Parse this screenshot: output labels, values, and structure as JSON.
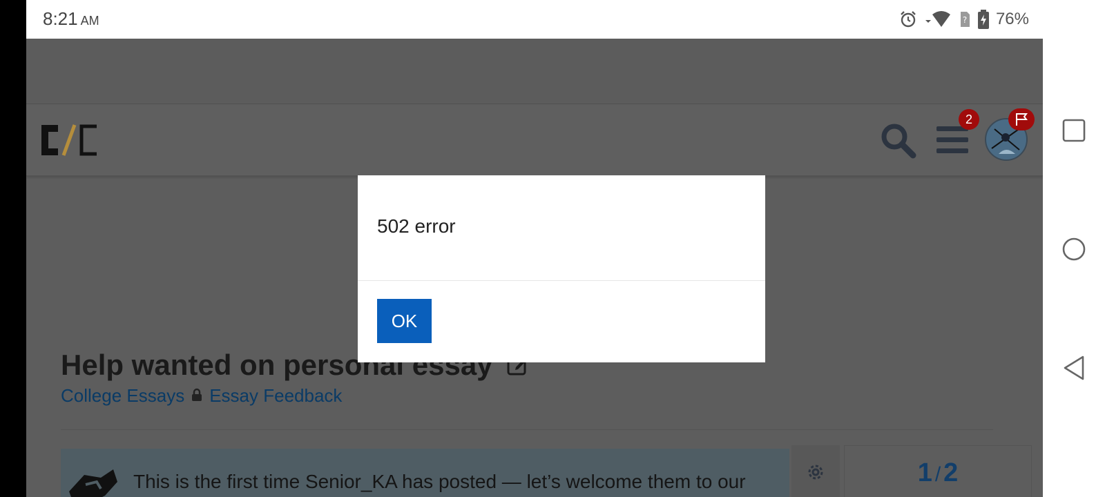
{
  "status_bar": {
    "time": "8:21",
    "ampm": "AM",
    "battery": "76%"
  },
  "header": {
    "logo_alt": "College Confidential",
    "notifications_count": "2"
  },
  "topic": {
    "title": "Help wanted on personal essay",
    "category": "College Essays",
    "subcategory": "Essay Feedback"
  },
  "welcome_banner": {
    "text": "This is the first time Senior_KA has posted — let’s welcome them to our"
  },
  "timeline": {
    "current": "1",
    "separator": "/",
    "total": "2"
  },
  "modal": {
    "message": "502 error",
    "ok_label": "OK"
  },
  "colors": {
    "brand_gold": "#b58e3c",
    "link_blue": "#0a3b66",
    "button_blue": "#0a5fbb",
    "badge_red": "#a10b0b"
  }
}
